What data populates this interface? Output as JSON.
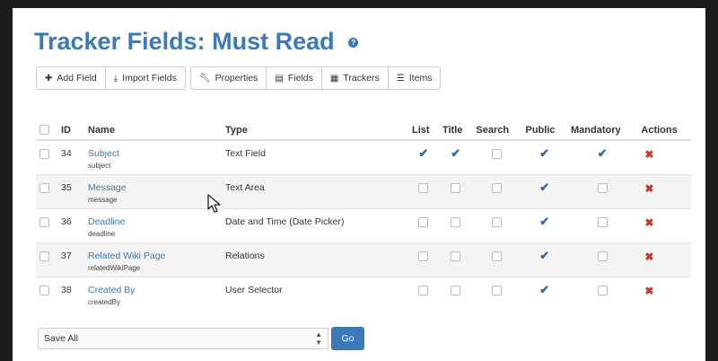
{
  "page": {
    "title": "Tracker Fields: Must Read",
    "help_icon": "?"
  },
  "toolbar": {
    "add_field": "Add Field",
    "import_fields": "Import Fields",
    "properties": "Properties",
    "fields": "Fields",
    "trackers": "Trackers",
    "items": "Items"
  },
  "table": {
    "headers": {
      "id": "ID",
      "name": "Name",
      "type": "Type",
      "list": "List",
      "title": "Title",
      "search": "Search",
      "public": "Public",
      "mandatory": "Mandatory",
      "actions": "Actions"
    },
    "rows": [
      {
        "id": "34",
        "name": "Subject",
        "perm": "subject",
        "type": "Text Field",
        "list": true,
        "title": true,
        "search": false,
        "public": true,
        "mandatory": true
      },
      {
        "id": "35",
        "name": "Message",
        "perm": "message",
        "type": "Text Area",
        "list": false,
        "title": false,
        "search": false,
        "public": true,
        "mandatory": false
      },
      {
        "id": "36",
        "name": "Deadline",
        "perm": "deadline",
        "type": "Date and Time (Date Picker)",
        "list": false,
        "title": false,
        "search": false,
        "public": true,
        "mandatory": false
      },
      {
        "id": "37",
        "name": "Related Wiki Page",
        "perm": "relatedWikiPage",
        "type": "Relations",
        "list": false,
        "title": false,
        "search": false,
        "public": true,
        "mandatory": false
      },
      {
        "id": "38",
        "name": "Created By",
        "perm": "createdBy",
        "type": "User Selector",
        "list": false,
        "title": false,
        "search": false,
        "public": true,
        "mandatory": false
      }
    ]
  },
  "bulk_action": {
    "selected": "Save All",
    "go_label": "Go"
  },
  "colors": {
    "accent": "#3b79b8",
    "delete": "#c0392b"
  },
  "icons": {
    "add": "plus-icon",
    "import": "download-icon",
    "properties": "wrench-icon",
    "fields": "list-icon",
    "trackers": "database-icon",
    "items": "list-icon",
    "delete": "remove-icon"
  }
}
